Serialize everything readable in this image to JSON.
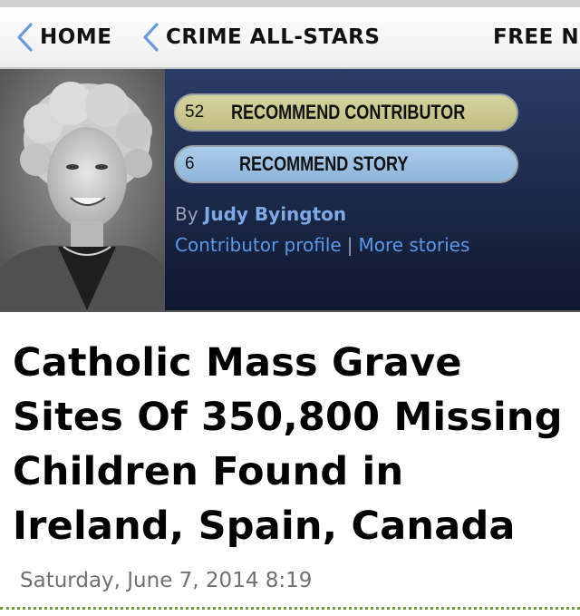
{
  "nav": {
    "items": [
      {
        "label": "HOME"
      },
      {
        "label": "CRIME ALL-STARS"
      },
      {
        "label": "FREE NE"
      }
    ]
  },
  "contributor": {
    "recommend_contributor": {
      "count": "52",
      "label": "RECOMMEND CONTRIBUTOR"
    },
    "recommend_story": {
      "count": "6",
      "label": "RECOMMEND STORY"
    },
    "by_prefix": "By",
    "author": "Judy Byington",
    "profile_link": "Contributor profile",
    "separator": "|",
    "more_link": "More stories"
  },
  "article": {
    "headline": "Catholic Mass Grave Sites Of 350,800 Missing Children Found in Ireland, Spain, Canada",
    "date": "Saturday, June 7, 2014 8:19"
  },
  "colors": {
    "hero_background": "#1b2848",
    "gold_pill": "#c9c78e",
    "blue_pill": "#9cc0e2",
    "link": "#5d98e8",
    "divider": "#6a9a3a"
  }
}
